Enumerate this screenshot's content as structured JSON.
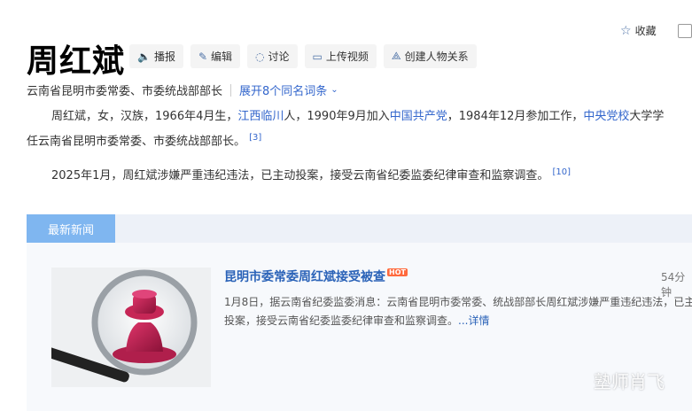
{
  "header": {
    "title": "周红斌",
    "collect_label": "收藏",
    "actions": [
      {
        "label": "播报",
        "icon": "speaker-icon"
      },
      {
        "label": "编辑",
        "icon": "pencil-icon"
      },
      {
        "label": "讨论",
        "icon": "chat-icon"
      },
      {
        "label": "上传视频",
        "icon": "video-icon"
      },
      {
        "label": "创建人物关系",
        "icon": "relationship-icon"
      }
    ],
    "subtitle": "云南省昆明市委常委、市委统战部部长",
    "expand_label": "展开8个同名词条"
  },
  "intro": {
    "p1_a": "周红斌，女，汉族，1966年4月生，",
    "p1_link1": "江西临川",
    "p1_b": "人，1990年9月加入",
    "p1_link2": "中国共产党",
    "p1_c": "，1984年12月参加工作，",
    "p1_link3": "中央党校",
    "p1_d": "大学学",
    "p1_e": "任云南省昆明市委常委、市委统战部部长。",
    "p1_ref": "[3]",
    "p2": "2025年1月，周红斌涉嫌严重违纪违法，已主动投案，接受云南省纪委监委纪律审查和监察调查。",
    "p2_ref": "[10]"
  },
  "news": {
    "tab_label": "最新新闻",
    "items": [
      {
        "title": "昆明市委常委周红斌接受被查",
        "hot_label": "HOT",
        "time": "54分钟",
        "body_line1": "1月8日，据云南省纪委监委消息：云南省昆明市委常委、统战部部长周红斌涉嫌严重违纪违法，已主",
        "body_line2": "投案，接受云南省纪委监委纪律审查和监察调查。",
        "more_label": "...详情"
      }
    ]
  },
  "watermark": "塾师肖飞"
}
